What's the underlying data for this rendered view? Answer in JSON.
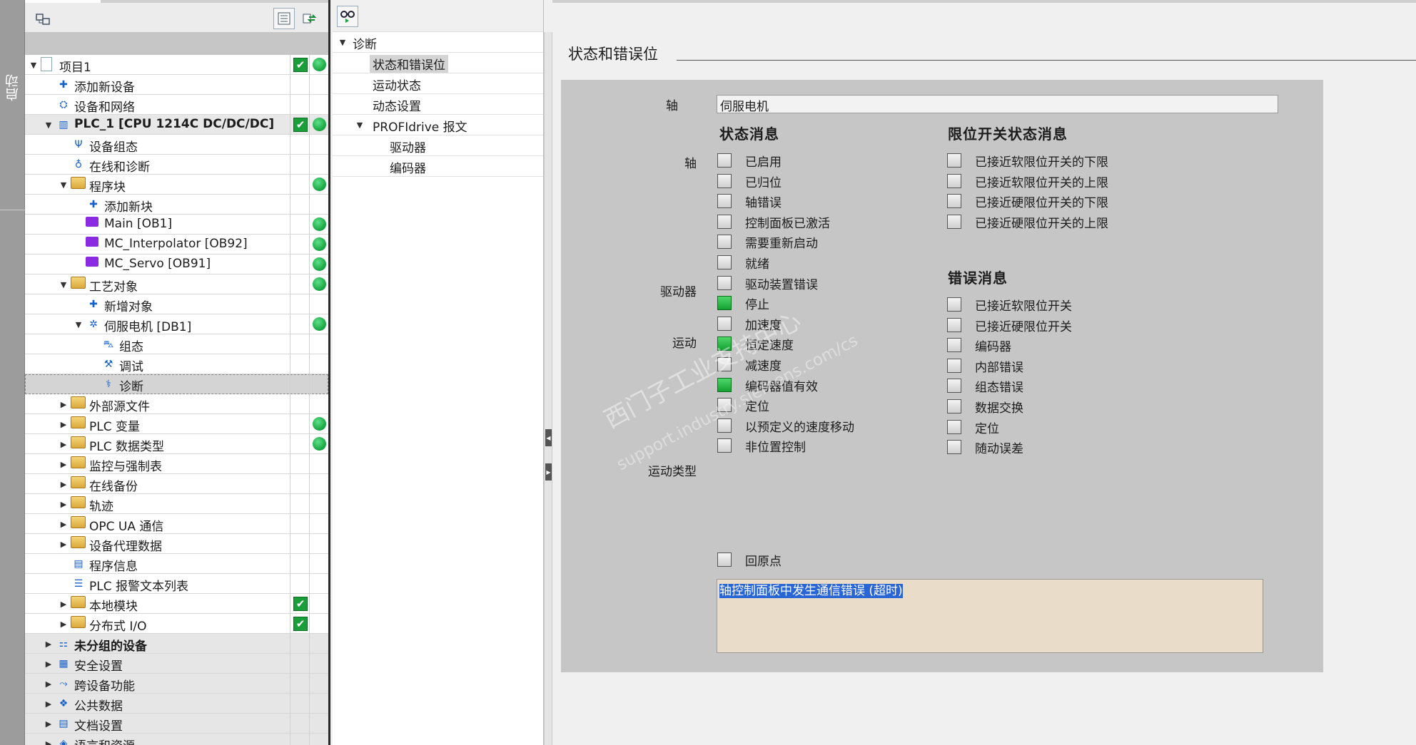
{
  "side_tab": {
    "label": "启动"
  },
  "tree": {
    "items": [
      {
        "label": "项目1",
        "level": 0,
        "arrow": "open",
        "icon": "project-icon",
        "check": true,
        "dot": true,
        "bold": false
      },
      {
        "label": "添加新设备",
        "level": 1,
        "arrow": "",
        "icon": "add-device-icon",
        "check": false,
        "dot": false
      },
      {
        "label": "设备和网络",
        "level": 1,
        "arrow": "",
        "icon": "network-icon",
        "check": false,
        "dot": false
      },
      {
        "label": "PLC_1 [CPU 1214C DC/DC/DC]",
        "level": 1,
        "arrow": "open",
        "icon": "plc-icon",
        "check": true,
        "dot": true,
        "bold": true,
        "hl": true
      },
      {
        "label": "设备组态",
        "level": 2,
        "arrow": "",
        "icon": "device-config-icon",
        "check": false,
        "dot": false
      },
      {
        "label": "在线和诊断",
        "level": 2,
        "arrow": "",
        "icon": "online-diag-icon",
        "check": false,
        "dot": false
      },
      {
        "label": "程序块",
        "level": 2,
        "arrow": "open",
        "icon": "folder-icon",
        "check": false,
        "dot": true
      },
      {
        "label": "添加新块",
        "level": 3,
        "arrow": "",
        "icon": "add-block-icon",
        "check": false,
        "dot": false
      },
      {
        "label": "Main [OB1]",
        "level": 3,
        "arrow": "",
        "icon": "ob-block-icon",
        "check": false,
        "dot": true
      },
      {
        "label": "MC_Interpolator [OB92]",
        "level": 3,
        "arrow": "",
        "icon": "ob-block-icon",
        "check": false,
        "dot": true
      },
      {
        "label": "MC_Servo [OB91]",
        "level": 3,
        "arrow": "",
        "icon": "ob-block-icon",
        "check": false,
        "dot": true
      },
      {
        "label": "工艺对象",
        "level": 2,
        "arrow": "open",
        "icon": "tech-object-folder-icon",
        "check": false,
        "dot": true
      },
      {
        "label": "新增对象",
        "level": 3,
        "arrow": "",
        "icon": "add-object-icon",
        "check": false,
        "dot": false
      },
      {
        "label": "伺服电机 [DB1]",
        "level": 3,
        "arrow": "open",
        "icon": "axis-icon",
        "check": false,
        "dot": true
      },
      {
        "label": "组态",
        "level": 4,
        "arrow": "",
        "icon": "config-icon",
        "check": false,
        "dot": false
      },
      {
        "label": "调试",
        "level": 4,
        "arrow": "",
        "icon": "commissioning-icon",
        "check": false,
        "dot": false
      },
      {
        "label": "诊断",
        "level": 4,
        "arrow": "",
        "icon": "diagnostics-icon",
        "check": false,
        "dot": false,
        "selected": true
      },
      {
        "label": "外部源文件",
        "level": 2,
        "arrow": "closed",
        "icon": "folder-icon",
        "check": false,
        "dot": false
      },
      {
        "label": "PLC 变量",
        "level": 2,
        "arrow": "closed",
        "icon": "folder-icon",
        "check": false,
        "dot": true
      },
      {
        "label": "PLC 数据类型",
        "level": 2,
        "arrow": "closed",
        "icon": "folder-icon",
        "check": false,
        "dot": true
      },
      {
        "label": "监控与强制表",
        "level": 2,
        "arrow": "closed",
        "icon": "folder-icon",
        "check": false,
        "dot": false
      },
      {
        "label": "在线备份",
        "level": 2,
        "arrow": "closed",
        "icon": "folder-icon",
        "check": false,
        "dot": false
      },
      {
        "label": "轨迹",
        "level": 2,
        "arrow": "closed",
        "icon": "folder-icon",
        "check": false,
        "dot": false
      },
      {
        "label": "OPC UA 通信",
        "level": 2,
        "arrow": "closed",
        "icon": "folder-icon",
        "check": false,
        "dot": false
      },
      {
        "label": "设备代理数据",
        "level": 2,
        "arrow": "closed",
        "icon": "folder-icon",
        "check": false,
        "dot": false
      },
      {
        "label": "程序信息",
        "level": 2,
        "arrow": "",
        "icon": "program-info-icon",
        "check": false,
        "dot": false
      },
      {
        "label": "PLC 报警文本列表",
        "level": 2,
        "arrow": "",
        "icon": "text-list-icon",
        "check": false,
        "dot": false
      },
      {
        "label": "本地模块",
        "level": 2,
        "arrow": "closed",
        "icon": "folder-icon",
        "check": true,
        "dot": false
      },
      {
        "label": "分布式 I/O",
        "level": 2,
        "arrow": "closed",
        "icon": "folder-icon",
        "check": true,
        "dot": false
      },
      {
        "label": "未分组的设备",
        "level": 1,
        "arrow": "closed",
        "icon": "ungrouped-icon",
        "check": false,
        "dot": false,
        "bold": true,
        "grp": true
      },
      {
        "label": "安全设置",
        "level": 1,
        "arrow": "closed",
        "icon": "security-icon",
        "check": false,
        "dot": false,
        "grp": true
      },
      {
        "label": "跨设备功能",
        "level": 1,
        "arrow": "closed",
        "icon": "cross-device-icon",
        "check": false,
        "dot": false,
        "grp": true
      },
      {
        "label": "公共数据",
        "level": 1,
        "arrow": "closed",
        "icon": "common-data-icon",
        "check": false,
        "dot": false,
        "grp": true
      },
      {
        "label": "文档设置",
        "level": 1,
        "arrow": "closed",
        "icon": "doc-settings-icon",
        "check": false,
        "dot": false,
        "grp": true
      },
      {
        "label": "语言和资源",
        "level": 1,
        "arrow": "closed",
        "icon": "language-icon",
        "check": false,
        "dot": false,
        "grp": true
      }
    ]
  },
  "nav": {
    "items": [
      {
        "label": "诊断",
        "indent": 0,
        "arrow": "open"
      },
      {
        "label": "状态和错误位",
        "indent": 1,
        "arrow": "",
        "selected": true
      },
      {
        "label": "运动状态",
        "indent": 1,
        "arrow": ""
      },
      {
        "label": "动态设置",
        "indent": 1,
        "arrow": ""
      },
      {
        "label": "PROFIdrive 报文",
        "indent": 1,
        "arrow": "open"
      },
      {
        "label": "驱动器",
        "indent": 2,
        "arrow": ""
      },
      {
        "label": "编码器",
        "indent": 2,
        "arrow": ""
      }
    ]
  },
  "main": {
    "section_title": "状态和错误位",
    "axis_label": "轴",
    "axis_value": "伺服电机",
    "status_head": "状态消息",
    "limit_head": "限位开关状态消息",
    "error_head": "错误消息",
    "group_labels": {
      "axis": "轴",
      "drive": "驱动器",
      "motion": "运动",
      "motion_type": "运动类型"
    },
    "status_items": [
      {
        "label": "已启用",
        "on": false
      },
      {
        "label": "已归位",
        "on": false
      },
      {
        "label": "轴错误",
        "on": false
      },
      {
        "label": "控制面板已激活",
        "on": false
      },
      {
        "label": "需要重新启动",
        "on": false
      },
      {
        "label": "就绪",
        "on": false
      },
      {
        "label": "驱动装置错误",
        "on": false
      },
      {
        "label": "停止",
        "on": true
      },
      {
        "label": "加速度",
        "on": false
      },
      {
        "label": "恒定速度",
        "on": true
      },
      {
        "label": "减速度",
        "on": false
      },
      {
        "label": "编码器值有效",
        "on": true
      },
      {
        "label": "定位",
        "on": false
      },
      {
        "label": "以预定义的速度移动",
        "on": false
      },
      {
        "label": "非位置控制",
        "on": false
      }
    ],
    "homing_item": {
      "label": "回原点",
      "on": false
    },
    "limit_items": [
      {
        "label": "已接近软限位开关的下限",
        "on": false
      },
      {
        "label": "已接近软限位开关的上限",
        "on": false
      },
      {
        "label": "已接近硬限位开关的下限",
        "on": false
      },
      {
        "label": "已接近硬限位开关的上限",
        "on": false
      }
    ],
    "error_items": [
      {
        "label": "已接近软限位开关",
        "on": false
      },
      {
        "label": "已接近硬限位开关",
        "on": false
      },
      {
        "label": "编码器",
        "on": false
      },
      {
        "label": "内部错误",
        "on": false
      },
      {
        "label": "组态错误",
        "on": false
      },
      {
        "label": "数据交换",
        "on": false
      },
      {
        "label": "定位",
        "on": false
      },
      {
        "label": "随动误差",
        "on": false
      }
    ],
    "message": "轴控制面板中发生通信错误 (超时)",
    "watermark_cn": "西门子工业支持中心",
    "watermark_url": "support.industry.siemens.com/cs"
  }
}
